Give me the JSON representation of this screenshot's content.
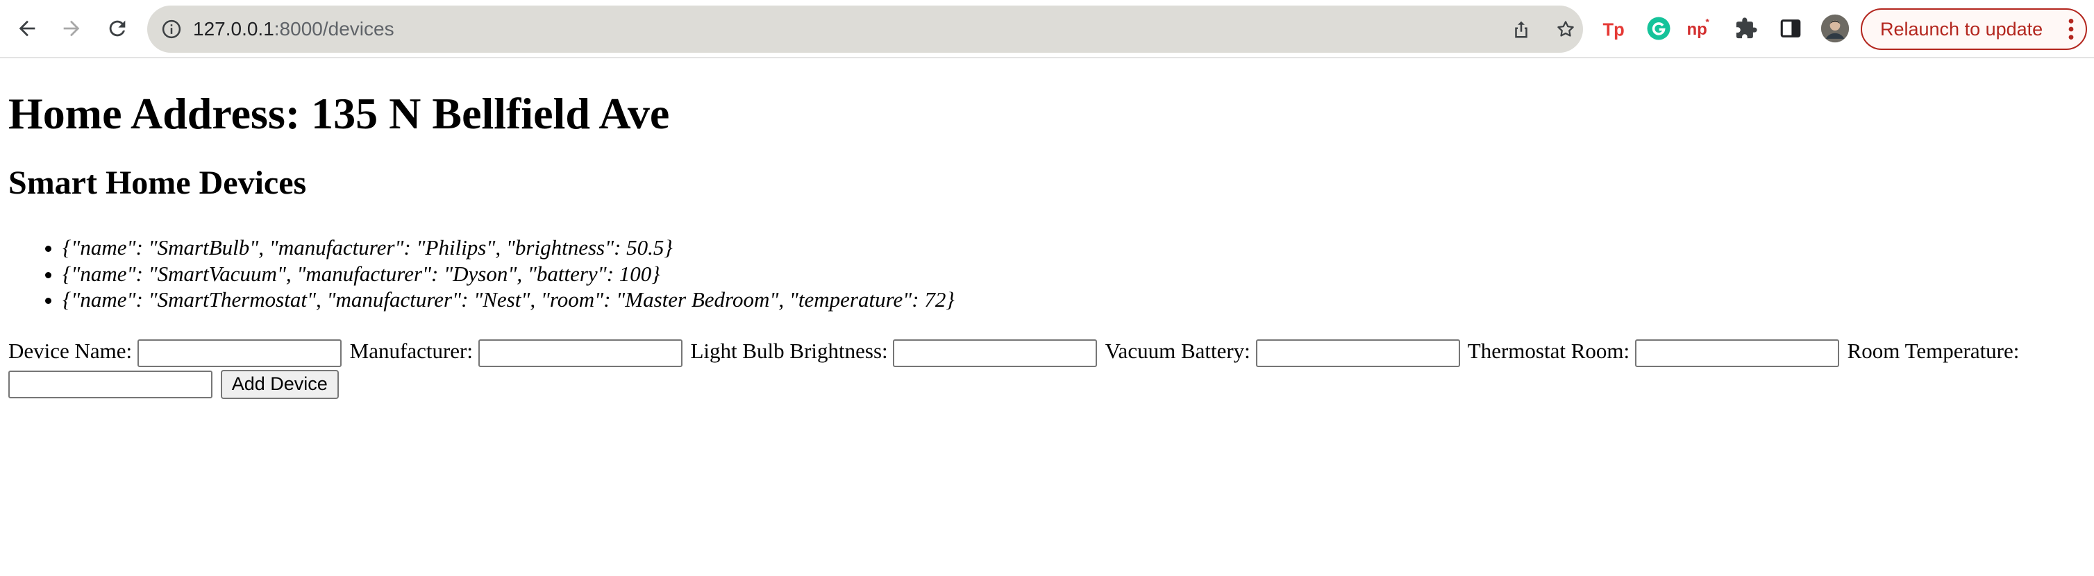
{
  "browser": {
    "url_host": "127.0.0.1",
    "url_path": ":8000/devices",
    "relaunch_label": "Relaunch to update",
    "extensions": [
      "tp-extension-icon",
      "grammarly-icon",
      "np-extension-icon",
      "puzzle-icon",
      "side-panel-icon",
      "profile-avatar"
    ],
    "accent": "#b3261e"
  },
  "page": {
    "title": "Home Address: 135 N Bellfield Ave",
    "subtitle": "Smart Home Devices",
    "devices": [
      "{\"name\": \"SmartBulb\", \"manufacturer\": \"Philips\", \"brightness\": 50.5}",
      "{\"name\": \"SmartVacuum\", \"manufacturer\": \"Dyson\", \"battery\": 100}",
      "{\"name\": \"SmartThermostat\", \"manufacturer\": \"Nest\", \"room\": \"Master Bedroom\", \"temperature\": 72}"
    ]
  },
  "form": {
    "device_name_label": "Device Name:",
    "manufacturer_label": "Manufacturer:",
    "brightness_label": "Light Bulb Brightness:",
    "battery_label": "Vacuum Battery:",
    "room_label": "Thermostat Room:",
    "temperature_label": "Room Temperature:",
    "device_name_value": "",
    "manufacturer_value": "",
    "brightness_value": "",
    "battery_value": "",
    "room_value": "",
    "temperature_value": "",
    "submit_label": "Add Device"
  }
}
